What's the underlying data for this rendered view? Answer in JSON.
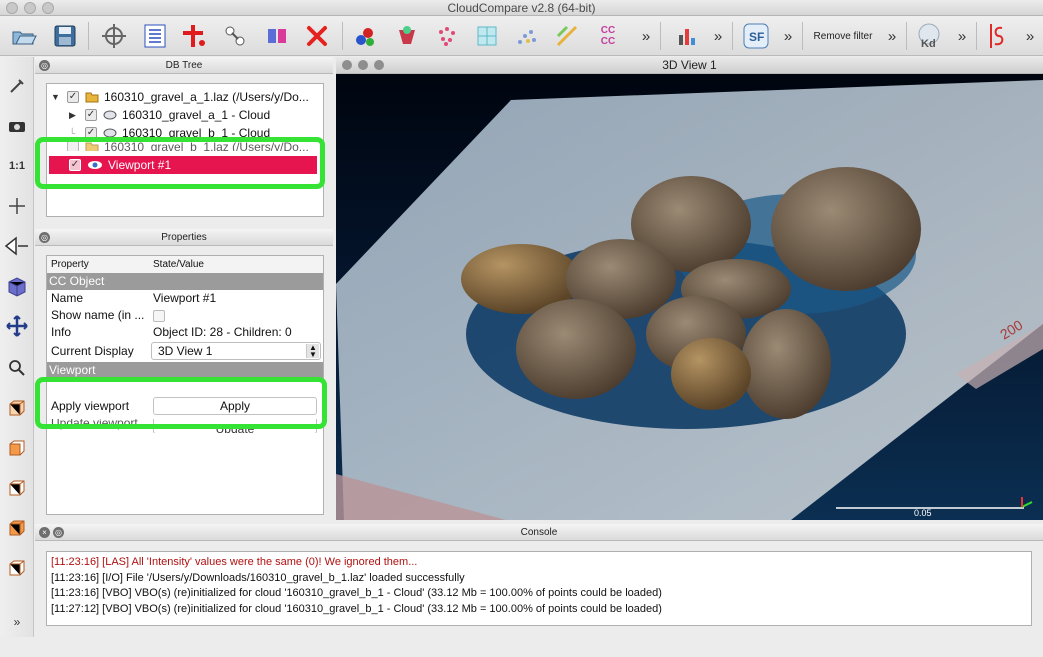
{
  "window": {
    "title": "CloudCompare v2.8 (64-bit)"
  },
  "toolbar": {
    "remove_filter_label": "Remove filter",
    "overflow_label": "»",
    "cc_label": "CC\nCC",
    "kd_label": "Kd",
    "sf_label": "SF",
    "icons": [
      "open-icon",
      "save-icon",
      "clipping-icon",
      "list-icon",
      "cross-section-icon",
      "transform-icon",
      "merge-icon",
      "delete-icon",
      "segment-icon",
      "rgb-icon",
      "sample-icon",
      "octree-icon",
      "scatter-icon",
      "sf-icon",
      "cc-icon",
      "histogram-icon",
      "sf-tools-icon",
      "kd-icon",
      "ls-icon"
    ]
  },
  "left_tools": {
    "scale_label": "1:1"
  },
  "dbtree": {
    "header": "DB Tree",
    "items": [
      {
        "label": "160310_gravel_a_1.laz (/Users/y/Do...",
        "level": 0,
        "checked": true,
        "expanded": true
      },
      {
        "label": "160310_gravel_a_1 - Cloud",
        "level": 1,
        "checked": true,
        "expanded": false
      },
      {
        "label": "160310_gravel_b_1 - Cloud",
        "level": 1,
        "checked": true
      },
      {
        "label": "160310_gravel_b_1.laz (/Users/y/Do...",
        "level": 0,
        "checked": true
      },
      {
        "label": "Viewport #1",
        "level": 0,
        "checked": true,
        "selected": true
      }
    ],
    "selection_color": "#e6154f"
  },
  "properties": {
    "header": "Properties",
    "col_property": "Property",
    "col_value": "State/Value",
    "section_cc": "CC Object",
    "name_label": "Name",
    "name_value": "Viewport #1",
    "showname_label": "Show name (in ...",
    "info_label": "Info",
    "info_value": "Object ID: 28 - Children: 0",
    "display_label": "Current Display",
    "display_value": "3D View 1",
    "section_viewport": "Viewport",
    "apply_label": "Apply viewport",
    "apply_button": "Apply",
    "update_label": "Update viewport",
    "update_button": "Update"
  },
  "view3d": {
    "header": "3D View 1",
    "scale_value": "0.05",
    "ruler_label": "200"
  },
  "console": {
    "header": "Console",
    "lines": [
      {
        "text": "[11:23:16] [LAS] All 'Intensity' values were the same (0)! We ignored them...",
        "color": "#b01010"
      },
      {
        "text": "[11:23:16] [I/O] File '/Users/y/Downloads/160310_gravel_b_1.laz' loaded successfully",
        "color": "#111111"
      },
      {
        "text": "[11:23:16] [VBO] VBO(s) (re)initialized for cloud '160310_gravel_b_1 - Cloud' (33.12 Mb = 100.00% of points could be loaded)",
        "color": "#111111"
      },
      {
        "text": "[11:27:12] [VBO] VBO(s) (re)initialized for cloud '160310_gravel_b_1 - Cloud' (33.12 Mb = 100.00% of points could be loaded)",
        "color": "#111111"
      }
    ]
  },
  "colors": {
    "highlight": "#35e335",
    "warning_text": "#b01010",
    "section_bg": "#9b9b9b"
  }
}
